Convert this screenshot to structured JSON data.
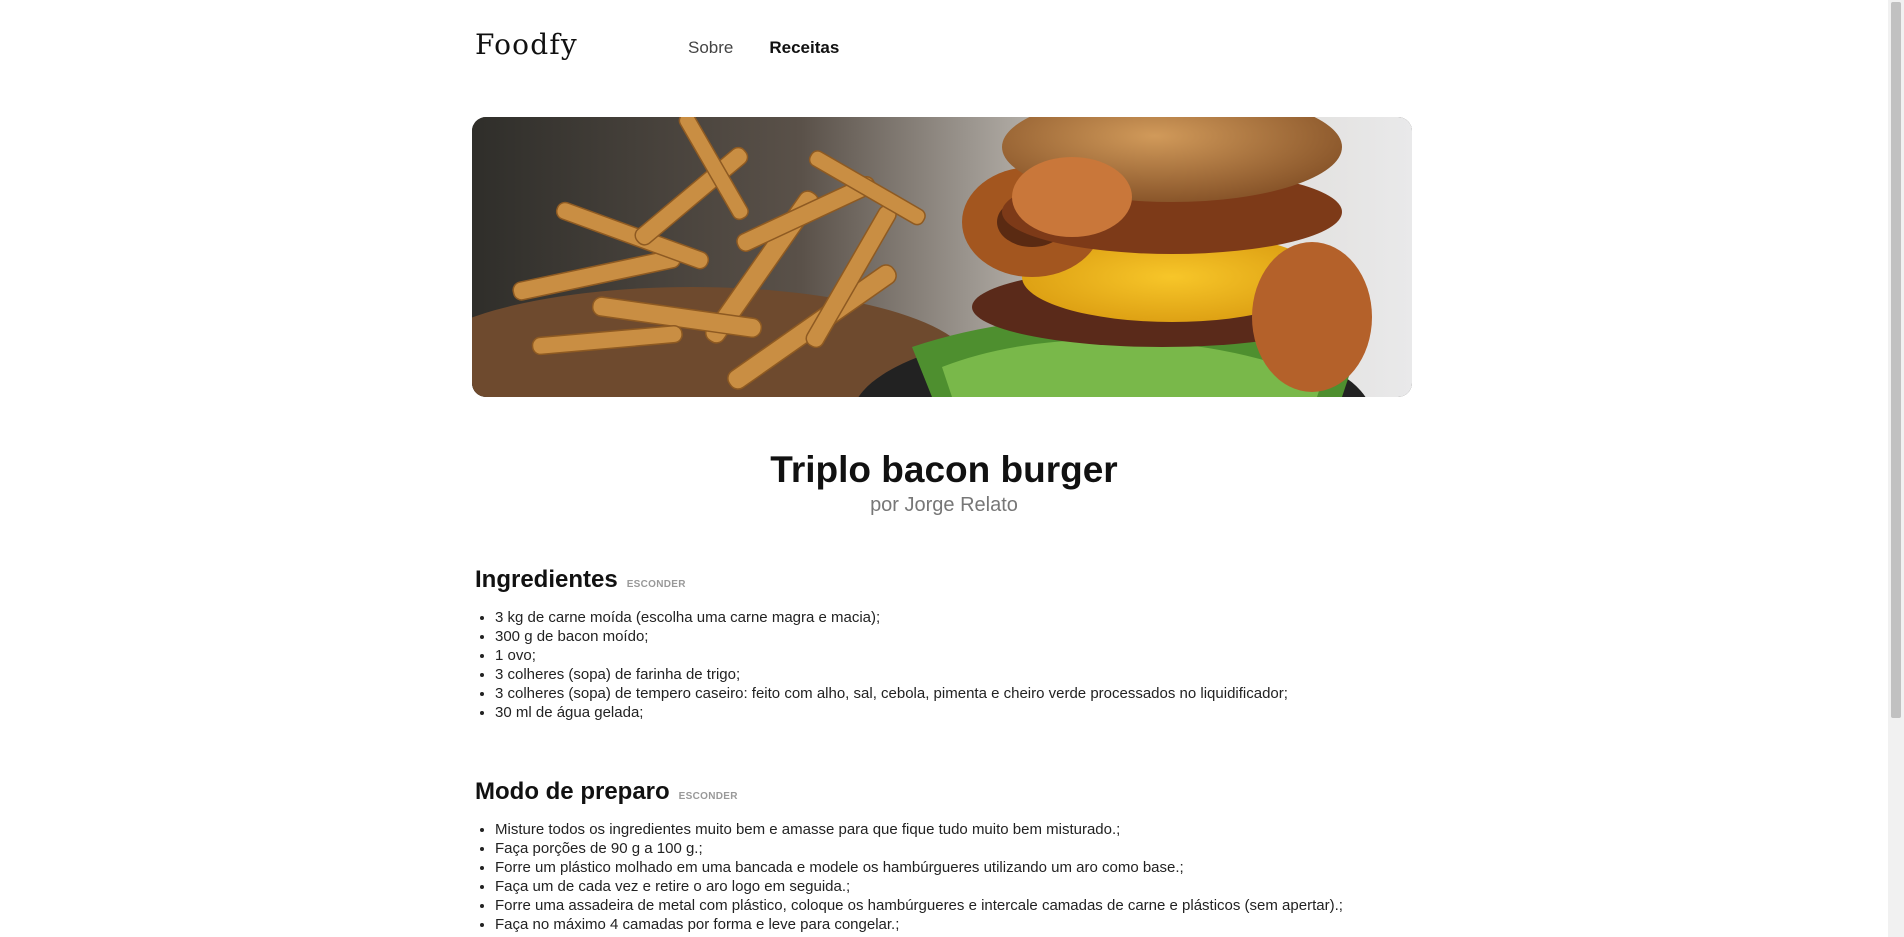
{
  "header": {
    "logo": "Foodfy",
    "nav": [
      {
        "label": "Sobre",
        "active": false
      },
      {
        "label": "Receitas",
        "active": true
      }
    ]
  },
  "recipe": {
    "title": "Triplo bacon burger",
    "author": "por Jorge Relato"
  },
  "ingredients": {
    "title": "Ingredientes",
    "toggle": "ESCONDER",
    "items": [
      "3 kg de carne moída (escolha uma carne magra e macia);",
      "300 g de bacon moído;",
      "1 ovo;",
      "3 colheres (sopa) de farinha de trigo;",
      "3 colheres (sopa) de tempero caseiro: feito com alho, sal, cebola, pimenta e cheiro verde processados no liquidificador;",
      "30 ml de água gelada;"
    ]
  },
  "preparation": {
    "title": "Modo de preparo",
    "toggle": "ESCONDER",
    "items": [
      "Misture todos os ingredientes muito bem e amasse para que fique tudo muito bem misturado.;",
      "Faça porções de 90 g a 100 g.;",
      "Forre um plástico molhado em uma bancada e modele os hambúrgueres utilizando um aro como base.;",
      "Faça um de cada vez e retire o aro logo em seguida.;",
      "Forre uma assadeira de metal com plástico, coloque os hambúrgueres e intercale camadas de carne e plásticos (sem apertar).;",
      "Faça no máximo 4 camadas por forma e leve para congelar.;"
    ]
  },
  "colors": {
    "text": "#111111",
    "muted": "#777777",
    "toggle": "#999999"
  }
}
